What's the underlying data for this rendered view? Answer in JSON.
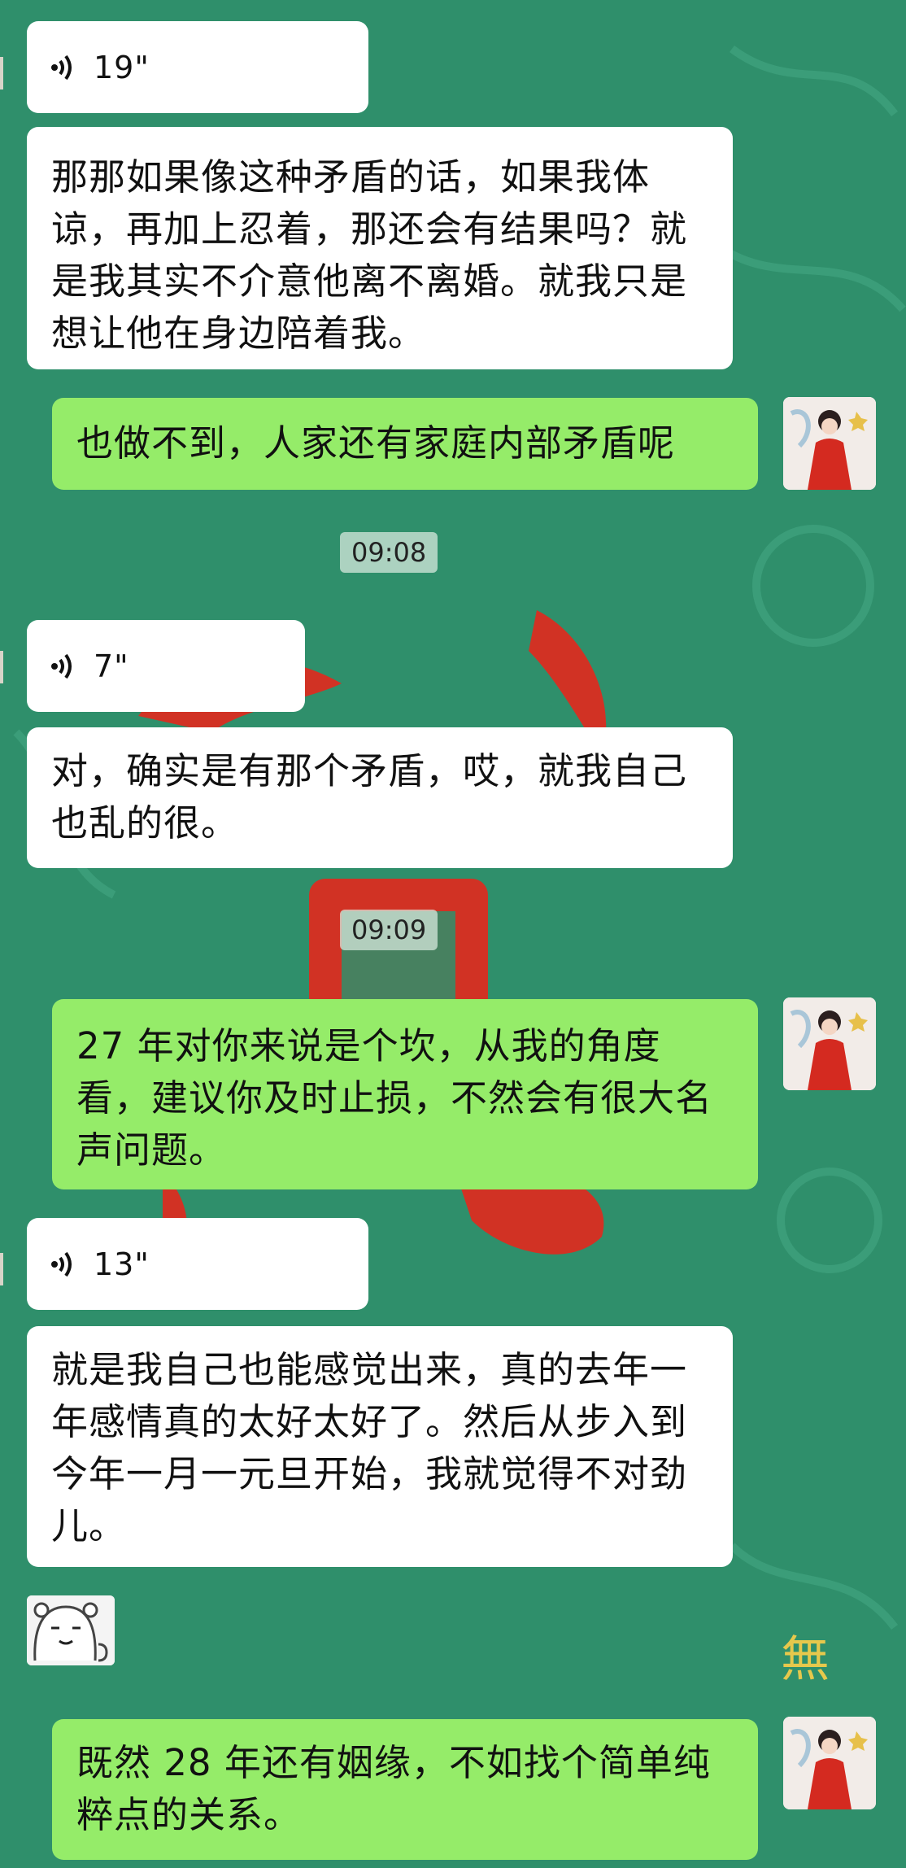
{
  "messages": [
    {
      "type": "voice",
      "side": "left",
      "duration": "19\""
    },
    {
      "type": "text",
      "side": "left",
      "text": "那那如果像这种矛盾的话，如果我体谅，再加上忍着，那还会有结果吗？就是我其实不介意他离不离婚。就我只是想让他在身边陪着我。"
    },
    {
      "type": "text",
      "side": "right",
      "text": "也做不到，人家还有家庭内部矛盾呢"
    },
    {
      "type": "time",
      "text": "09:08"
    },
    {
      "type": "voice",
      "side": "left",
      "duration": "7\""
    },
    {
      "type": "text",
      "side": "left",
      "text": "对，确实是有那个矛盾，哎，就我自己也乱的很。"
    },
    {
      "type": "time",
      "text": "09:09"
    },
    {
      "type": "text",
      "side": "right",
      "text": "27 年对你来说是个坎，从我的角度看，建议你及时止损，不然会有很大名声问题。"
    },
    {
      "type": "voice",
      "side": "left",
      "duration": "13\""
    },
    {
      "type": "text",
      "side": "left",
      "text": "就是我自己也能感觉出来，真的去年一年感情真的太好太好了。然后从步入到今年一月一元旦开始，我就觉得不对劲儿。"
    },
    {
      "type": "sticker",
      "side": "left",
      "icon": "bear-sticker"
    },
    {
      "type": "text",
      "side": "right",
      "text": "既然 28 年还有姻缘，不如找个简单纯粹点的关系。"
    }
  ],
  "colors": {
    "background": "#2f8f6b",
    "left_bubble": "#ffffff",
    "right_bubble": "#95ec69",
    "red_decor": "#e02a1e"
  },
  "icons": {
    "voice": "voice-wave-icon",
    "avatar": "avatar-woman-red-hanfu"
  }
}
